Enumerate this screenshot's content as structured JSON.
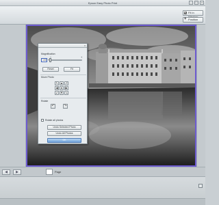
{
  "window": {
    "title": "Epson Easy Photo Print",
    "controls": [
      "–",
      "□",
      "×"
    ]
  },
  "toolbar": {
    "fit_in_window_label": "Fit in Window",
    "position_label": "Position",
    "fit_in_window_checked": true
  },
  "dialog": {
    "close_glyph": "×",
    "magnification_label": "Magnification",
    "magnification_value": "100",
    "percent_sign": "%",
    "slider_min_glyph": "−",
    "slider_max_glyph": "+",
    "reset_label": "Reset",
    "fit_label": "Fit",
    "move_photo_label": "Move Photo",
    "move_arrows": {
      "up_left": "↖",
      "up": "▲",
      "up_right": "↗",
      "left": "◀",
      "center": "●",
      "right": "▶",
      "down_left": "↙",
      "down": "▼",
      "down_right": "↘"
    },
    "rotate_label": "Rotate",
    "rotate_left_glyph": "↶",
    "rotate_right_glyph": "↷",
    "rotate_all_photos_label": "Rotate all photos",
    "rotate_all_checked": false,
    "undo_selected_label": "Undo Selected Photo",
    "undo_all_label": "Undo All Photos",
    "ok_label": "OK"
  },
  "bottom": {
    "prev_glyph": "◀",
    "next_glyph": "▶",
    "page_value": "1",
    "page_label": "Page"
  },
  "colors": {
    "photo_border": "#6d5bd0",
    "ok_button": "#6fa1da"
  }
}
